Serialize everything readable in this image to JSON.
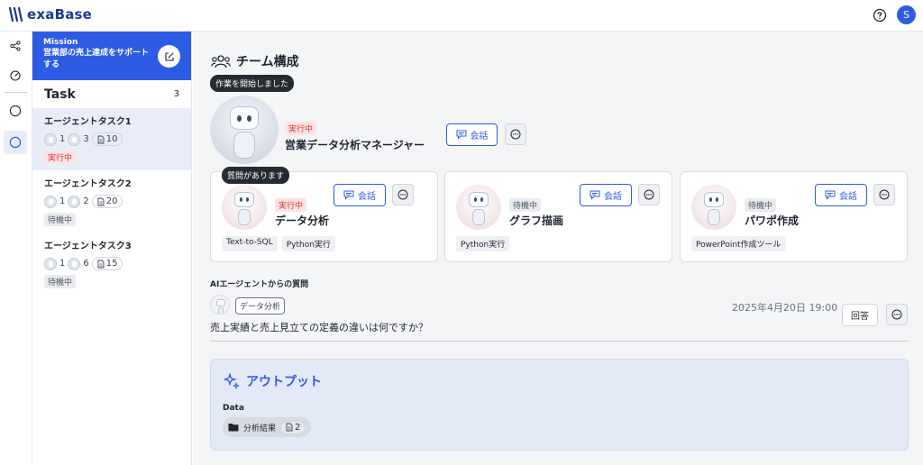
{
  "app": {
    "name": "exaBase",
    "user_initial": "S"
  },
  "mission": {
    "title": "Mission",
    "description": "営業部の売上達成をサポートする"
  },
  "tasks": {
    "header": "Task",
    "count": "3",
    "items": [
      {
        "name": "エージェントタスク1",
        "agents_a": "1",
        "agents_b": "3",
        "docs": "10",
        "status": "実行中"
      },
      {
        "name": "エージェントタスク2",
        "agents_a": "1",
        "agents_b": "2",
        "docs": "20",
        "status": "待機中"
      },
      {
        "name": "エージェントタスク3",
        "agents_a": "1",
        "agents_b": "6",
        "docs": "15",
        "status": "待機中"
      }
    ]
  },
  "team": {
    "title": "チーム構成",
    "manager": {
      "tooltip": "作業を開始しました",
      "status": "実行中",
      "name": "営業データ分析マネージャー",
      "chat_label": "会話"
    },
    "agents": [
      {
        "tooltip": "質問があります",
        "status": "実行中",
        "name": "データ分析",
        "chat_label": "会話",
        "tags": [
          "Text-to-SQL",
          "Python実行"
        ]
      },
      {
        "status": "待機中",
        "name": "グラフ描画",
        "chat_label": "会話",
        "tags": [
          "Python実行"
        ]
      },
      {
        "status": "待機中",
        "name": "パワポ作成",
        "chat_label": "会話",
        "tags": [
          "PowerPoint作成ツール"
        ]
      }
    ]
  },
  "question": {
    "label": "AIエージェントからの質問",
    "agent_chip": "データ分析",
    "date": "2025年4月20日 19:00",
    "answer_label": "回答",
    "text": "売上実績と売上見立ての定義の違いは何ですか？"
  },
  "output": {
    "title": "アウトプット",
    "section": "Data",
    "folder": "分析結果",
    "count": "2"
  },
  "colors": {
    "accent": "#2d5be3",
    "running": "#e03030",
    "waiting": "#4b5563"
  },
  "icons": [
    "logo-icon",
    "help-icon",
    "workflow-icon",
    "dashboard-icon",
    "circle-icon",
    "edit-icon",
    "team-icon",
    "chat-icon",
    "more-icon",
    "document-icon",
    "sparkle-icon",
    "folder-icon"
  ]
}
